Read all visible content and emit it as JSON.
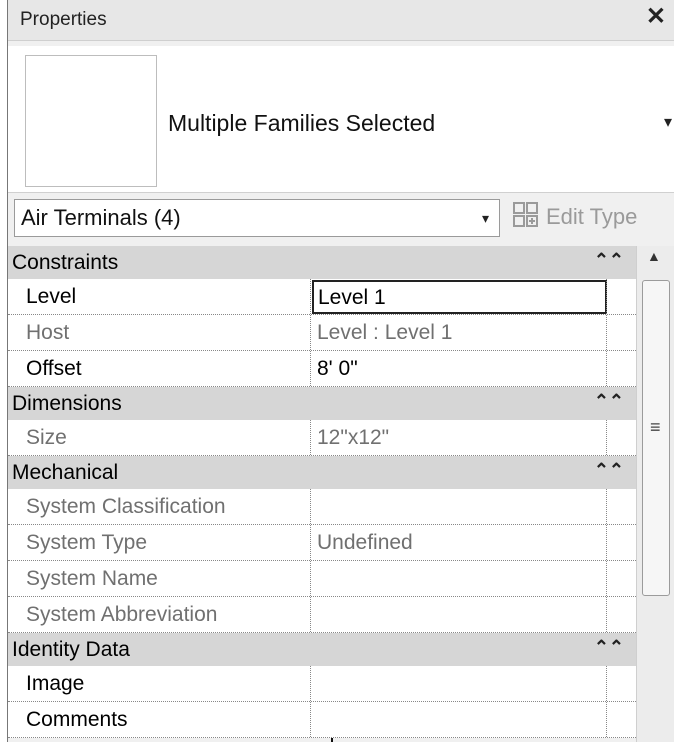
{
  "panel": {
    "title": "Properties",
    "close_glyph": "✕"
  },
  "preview": {
    "label": "Multiple Families Selected",
    "dropdown_glyph": "▾"
  },
  "filter": {
    "value": "Air Terminals (4)",
    "dropdown_glyph": "▾",
    "edit_type_label": "Edit Type",
    "edit_type_icon": "edit-type-icon"
  },
  "sections": [
    {
      "title": "Constraints",
      "collapse_glyph": "⌃⌃",
      "rows": [
        {
          "name": "Level",
          "value": "Level 1",
          "editable": true
        },
        {
          "name": "Host",
          "value": "Level : Level 1",
          "editable": false
        },
        {
          "name": "Offset",
          "value": "8'  0\"",
          "editable": true
        }
      ]
    },
    {
      "title": "Dimensions",
      "collapse_glyph": "⌃⌃",
      "rows": [
        {
          "name": "Size",
          "value": "12\"x12\"",
          "editable": false
        }
      ]
    },
    {
      "title": "Mechanical",
      "collapse_glyph": "⌃⌃",
      "rows": [
        {
          "name": "System Classification",
          "value": "",
          "editable": false
        },
        {
          "name": "System Type",
          "value": "Undefined",
          "editable": false
        },
        {
          "name": "System Name",
          "value": "",
          "editable": false
        },
        {
          "name": "System Abbreviation",
          "value": "",
          "editable": false
        }
      ]
    },
    {
      "title": "Identity Data",
      "collapse_glyph": "⌃⌃",
      "rows": [
        {
          "name": "Image",
          "value": "",
          "editable": true
        },
        {
          "name": "Comments",
          "value": "",
          "editable": true
        }
      ]
    }
  ],
  "scrollbar": {
    "up_glyph": "▲",
    "grip_glyph": "≡"
  },
  "colors": {
    "section_bg": "#d6d6d6",
    "disabled_text": "#707070",
    "panel_bg": "#f0f0f0"
  }
}
